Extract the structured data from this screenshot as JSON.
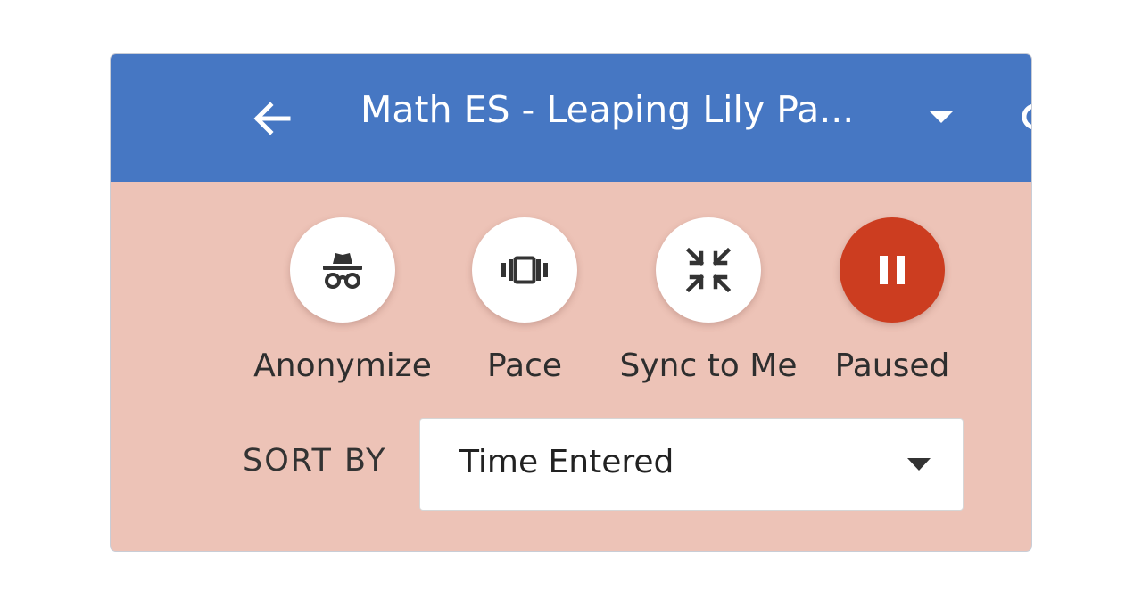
{
  "header": {
    "title": "Math ES - Leaping Lily Pa...",
    "back_icon": "arrow-left-icon",
    "dropdown_icon": "caret-down-icon"
  },
  "tools": [
    {
      "id": "anonymize",
      "label": "Anonymize",
      "icon": "incognito-icon",
      "active": false
    },
    {
      "id": "pace",
      "label": "Pace",
      "icon": "pace-icon",
      "active": false
    },
    {
      "id": "sync",
      "label": "Sync to Me",
      "icon": "sync-compress-icon",
      "active": false
    },
    {
      "id": "paused",
      "label": "Paused",
      "icon": "pause-icon",
      "active": true
    }
  ],
  "sort": {
    "label": "SORT BY",
    "selected": "Time Entered"
  },
  "colors": {
    "header": "#4677c3",
    "panel": "#edc3b7",
    "active": "#cc3d20",
    "button": "#ffffff"
  }
}
